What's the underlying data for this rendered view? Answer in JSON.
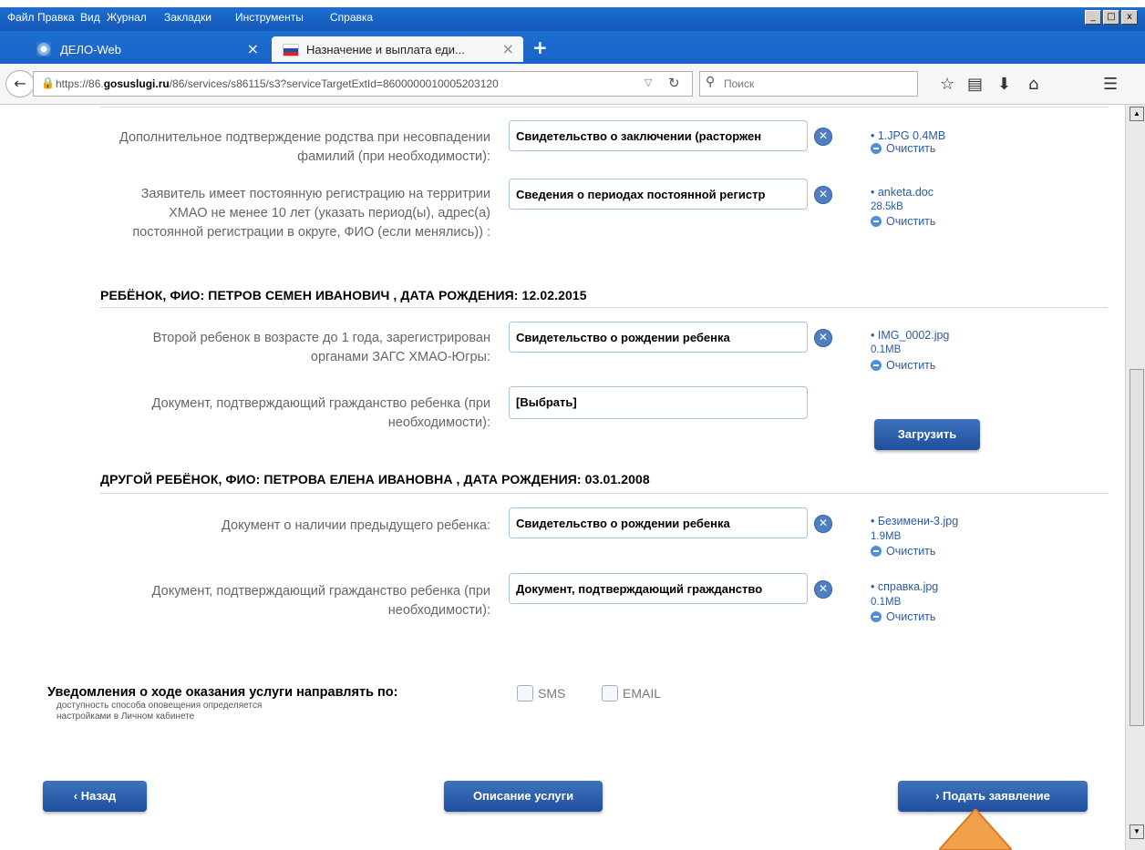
{
  "menu": {
    "items": [
      "Файл",
      "Правка",
      "Вид",
      "Журнал",
      "Закладки",
      "Инструменты",
      "Справка"
    ]
  },
  "window_controls": {
    "minimize": "_",
    "maximize": "□",
    "close": "x"
  },
  "tabs": [
    {
      "label": "ДЕЛО-Web",
      "close": "×"
    },
    {
      "label": "Назначение и выплата еди...",
      "close": "×"
    }
  ],
  "new_tab": "+",
  "nav": {
    "url_prefix": "https://86.",
    "url_host": "gosuslugi.ru",
    "url_rest": "/86/services/s86115/s3?serviceTargetExtId=8600000010005203120",
    "search_placeholder": "Поиск"
  },
  "rows": [
    {
      "label": "Дополнительное подтверждение родства при несовпадении фамилий (при необходимости):",
      "select": "Свидетельство о заключении (расторжен",
      "file": "• 1.JPG   0.4MB",
      "file2": "",
      "clear": "Очистить"
    },
    {
      "label": "Заявитель имеет постоянную регистрацию на территрии ХМАО не менее 10 лет (указать период(ы), адрес(а) постоянной регистрации в округе, ФИО (если менялись)) :",
      "select": "Сведения о периодах постоянной регистр",
      "file": "• anketa.doc",
      "file2": "28.5kB",
      "clear": "Очистить"
    },
    {
      "label": "Второй ребенок в возрасте до 1 года, зарегистрирован органами ЗАГС ХМАО-Югры:",
      "select": "Свидетельство о рождении ребенка",
      "file": "• IMG_0002.jpg",
      "file2": "0.1MB",
      "clear": "Очистить"
    },
    {
      "label": "Документ, подтверждающий гражданство ребенка (при необходимости):",
      "select": "[Выбрать]",
      "upload": "Загрузить"
    },
    {
      "label": "Документ о наличии предыдущего ребенка:",
      "select": "Свидетельство о рождении ребенка",
      "file": "• Безимени-3.jpg",
      "file2": "1.9MB",
      "clear": "Очистить"
    },
    {
      "label": "Документ, подтверждающий гражданство ребенка (при необходимости):",
      "select": "Документ, подтверждающий гражданство",
      "file": "• справка.jpg",
      "file2": "0.1MB",
      "clear": "Очистить"
    }
  ],
  "sections": [
    "РЕБЁНОК, ФИО: ПЕТРОВ СЕМЕН ИВАНОВИЧ , ДАТА РОЖДЕНИЯ: 12.02.2015",
    "ДРУГОЙ РЕБЁНОК, ФИО: ПЕТРОВА ЕЛЕНА ИВАНОВНА , ДАТА РОЖДЕНИЯ: 03.01.2008"
  ],
  "notify": {
    "title": "Уведомления о ходе оказания услуги направлять по:",
    "hint_line1": "доступность способа оповещения определяется",
    "hint_line2": "настройками в Личном кабинете",
    "sms": "SMS",
    "email": "EMAIL"
  },
  "buttons": {
    "back": "‹ Назад",
    "description": "Описание услуги",
    "submit": "› Подать заявление"
  },
  "colors": {
    "accent": "#2a5fac",
    "titlebar": "#1d6fd0",
    "link": "#2c5aa0"
  }
}
